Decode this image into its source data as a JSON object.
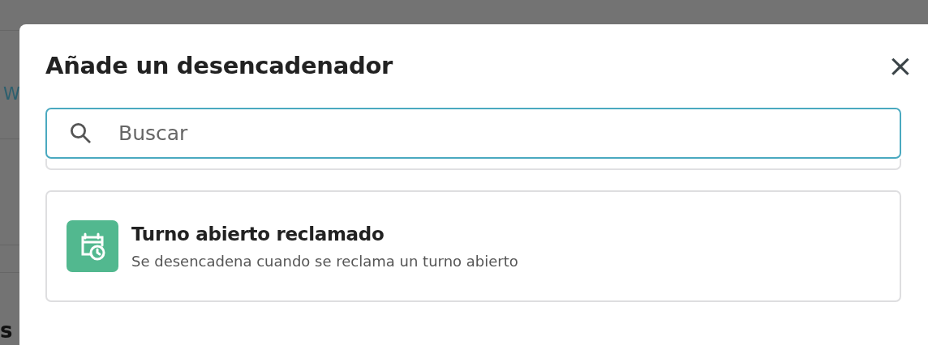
{
  "background_page": {
    "link_text": "W",
    "heading_text": "s"
  },
  "dialog": {
    "title": "Añade un desencadenador",
    "close_label": "×",
    "search": {
      "placeholder": "Buscar"
    },
    "triggers": [
      {
        "kind": "partial"
      },
      {
        "kind": "full",
        "title": "Turno abierto reclamado",
        "description": "Se desencadena cuando se reclama un turno abierto"
      }
    ]
  }
}
